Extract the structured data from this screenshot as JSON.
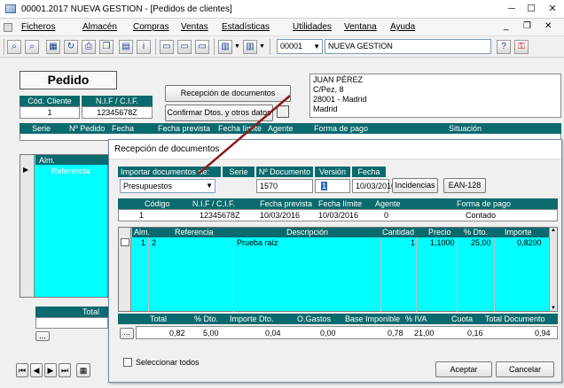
{
  "window": {
    "title": "00001.2017 NUEVA GESTION - [Pedidos de clientes]",
    "minimize": "─",
    "maximize": "☐",
    "close": "✕"
  },
  "menu": {
    "items": [
      "Ficheros",
      "Almacén",
      "Compras",
      "Ventas",
      "Estadísticas",
      "Utilidades",
      "Ventana",
      "Ayuda"
    ]
  },
  "toolbar": {
    "company_code": "00001",
    "company_name": "NUEVA GESTION"
  },
  "order": {
    "title": "Pedido",
    "headers": {
      "client_code": "Cód. Cliente",
      "nif": "N.I.F / C.I.F."
    },
    "client_code": "1",
    "nif": "12345678Z",
    "btn_reception": "Recepción de documentos",
    "btn_confirm": "Confirmar Dtos. y otros datos",
    "address_lines": [
      "JUAN PÉREZ",
      "C/Pez, 8",
      "28001 - Madrid",
      "Madrid"
    ],
    "list_headers": [
      "Serie",
      "Nº Pedido",
      "Fecha",
      "Fecha prevista",
      "Fecha límite",
      "Agente",
      "Forma de pago",
      "Situación"
    ],
    "lines_headers": {
      "alm": "Alm.",
      "ref": "Referencia"
    },
    "total_label": "Total",
    "ellipsis": "..."
  },
  "dialog": {
    "title": "Recepción de documentos",
    "import_label": "Importar documentos de:",
    "import_value": "Presupuestos",
    "headers": {
      "serie": "Serie",
      "num": "Nº Documento",
      "version": "Versión",
      "fecha": "Fecha"
    },
    "num": "1570",
    "version": "1",
    "fecha": "10/03/2016",
    "btn_incidencias": "Incidencias",
    "btn_ean": "EAN-128",
    "client_headers": [
      "Código",
      "N.I.F / C.I.F.",
      "Fecha prevista",
      "Fecha límite",
      "Agente",
      "Forma de pago"
    ],
    "client_values": [
      "1",
      "12345678Z",
      "10/03/2016",
      "10/03/2016",
      "0",
      "Contado"
    ],
    "line_headers": [
      "Alm.",
      "Referencia",
      "Descripción",
      "Cantidad",
      "Precio",
      "% Dto.",
      "Importe"
    ],
    "lines": [
      {
        "alm": "1",
        "ref": "2",
        "desc": "Prueba raíz",
        "qty": "1",
        "price": "1,1000",
        "dto": "25,00",
        "amount": "0,8200"
      }
    ],
    "totals_headers": [
      "Total",
      "% Dto.",
      "Importe Dto.",
      "O.Gastos",
      "Base Imponible",
      "% IVA",
      "Cuota",
      "Total Documento"
    ],
    "totals_values": [
      "0,82",
      "5,00",
      "0,04",
      "0,00",
      "0,78",
      "21,00",
      "0,16",
      "0,94"
    ],
    "ellipsis": "...",
    "select_all": "Seleccionar todos",
    "btn_accept": "Aceptar",
    "btn_cancel": "Cancelar"
  },
  "colors": {
    "header": "#0b6a6e",
    "grid": "#00ffff",
    "arrow": "#8b1a1a"
  }
}
